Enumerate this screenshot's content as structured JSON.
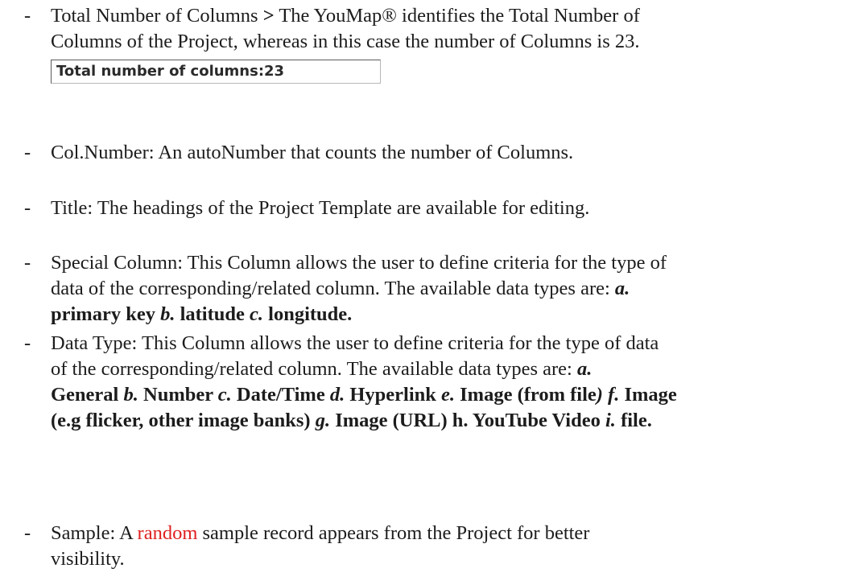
{
  "items": [
    {
      "dash": "-",
      "line1_a": "Total Number of Columns ",
      "line1_gt": ">",
      "line1_b": " The YouMap® identifies the Total Number of",
      "line2": "Columns of the Project, whereas in this case the number of Columns is 23."
    },
    {
      "dash": "-",
      "text": "Col.Number: An autoNumber that counts the number of Columns."
    },
    {
      "dash": "-",
      "text": "Title: The headings of the Project Template are available for editing."
    },
    {
      "dash": "-",
      "line1": "Special Column: This Column allows the user to define criteria for the type of",
      "line2_a": "data of the corresponding/related column. The available data types are: ",
      "opts": [
        {
          "letter": "a.",
          "label": ""
        },
        {
          "letter": "b.",
          "label": " latitude "
        },
        {
          "letter": "c.",
          "label": " longitude."
        }
      ],
      "line3_a": "primary key "
    },
    {
      "dash": "-",
      "line1": "Data Type: This Column allows the user to define criteria for the type of data",
      "line2_a": "of the corresponding/related column. The available data types are: ",
      "line2_letter": "a.",
      "line3": [
        {
          "text": "General ",
          "italic": false
        },
        {
          "text": "b.",
          "italic": true
        },
        {
          "text": " Number ",
          "italic": false
        },
        {
          "text": "c.",
          "italic": true
        },
        {
          "text": " Date/Time ",
          "italic": false
        },
        {
          "text": "d.",
          "italic": true
        },
        {
          "text": " Hyperlink ",
          "italic": false
        },
        {
          "text": "e.",
          "italic": true
        },
        {
          "text": " Image (from file",
          "italic": false
        },
        {
          "text": ")",
          "italic": true
        },
        {
          "text": " ",
          "italic": false
        },
        {
          "text": "f.",
          "italic": true
        },
        {
          "text": " Image",
          "italic": false
        }
      ],
      "line4": [
        {
          "text": "(e.g flicker, other image banks) ",
          "italic": false
        },
        {
          "text": "g.",
          "italic": true
        },
        {
          "text": " Image (URL) h. YouTube Video ",
          "italic": false
        },
        {
          "text": "i.",
          "italic": true
        },
        {
          "text": " file.",
          "italic": false
        }
      ]
    },
    {
      "dash": "-",
      "line1_a": "Sample: A ",
      "line1_red": "random",
      "line1_b": " sample record appears from the Project for better",
      "line2": "visibility."
    }
  ],
  "total_box": {
    "label": "Total number of columns:",
    "value": "23"
  }
}
